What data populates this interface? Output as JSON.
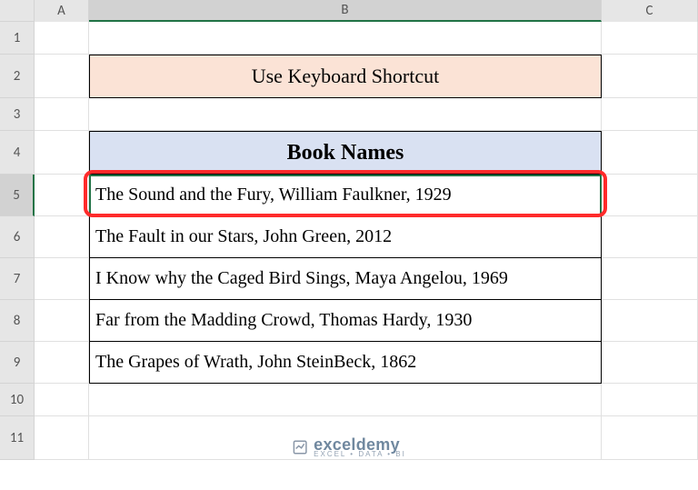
{
  "columns": {
    "A": "A",
    "B": "B",
    "C": "C"
  },
  "rows": {
    "r1": "1",
    "r2": "2",
    "r3": "3",
    "r4": "4",
    "r5": "5",
    "r6": "6",
    "r7": "7",
    "r8": "8",
    "r9": "9",
    "r10": "10",
    "r11": "11"
  },
  "title": "Use Keyboard Shortcut",
  "table_header": "Book Names",
  "books": [
    "The Sound and the Fury, William Faulkner, 1929",
    "The Fault in our Stars, John Green, 2012",
    "I Know why the Caged Bird Sings, Maya Angelou, 1969",
    "Far from the Madding Crowd, Thomas Hardy, 1930",
    "The Grapes of Wrath, John SteinBeck, 1862"
  ],
  "watermark": {
    "brand": "exceldemy",
    "tagline": "EXCEL • DATA • BI"
  },
  "row_heights": {
    "r1": 36,
    "r2": 48,
    "r3": 36,
    "r4": 48,
    "r5": 46,
    "r6": 46,
    "r7": 46,
    "r8": 46,
    "r9": 46,
    "r10": 36,
    "r11": 48
  },
  "selected_cell": "B5",
  "highlighted_row": 5,
  "chart_data": {
    "type": "table",
    "title": "Book Names",
    "columns": [
      "Book Names"
    ],
    "rows": [
      [
        "The Sound and the Fury, William Faulkner, 1929"
      ],
      [
        "The Fault in our Stars, John Green, 2012"
      ],
      [
        "I Know why the Caged Bird Sings, Maya Angelou, 1969"
      ],
      [
        "Far from the Madding Crowd, Thomas Hardy, 1930"
      ],
      [
        "The Grapes of Wrath, John SteinBeck, 1862"
      ]
    ]
  }
}
